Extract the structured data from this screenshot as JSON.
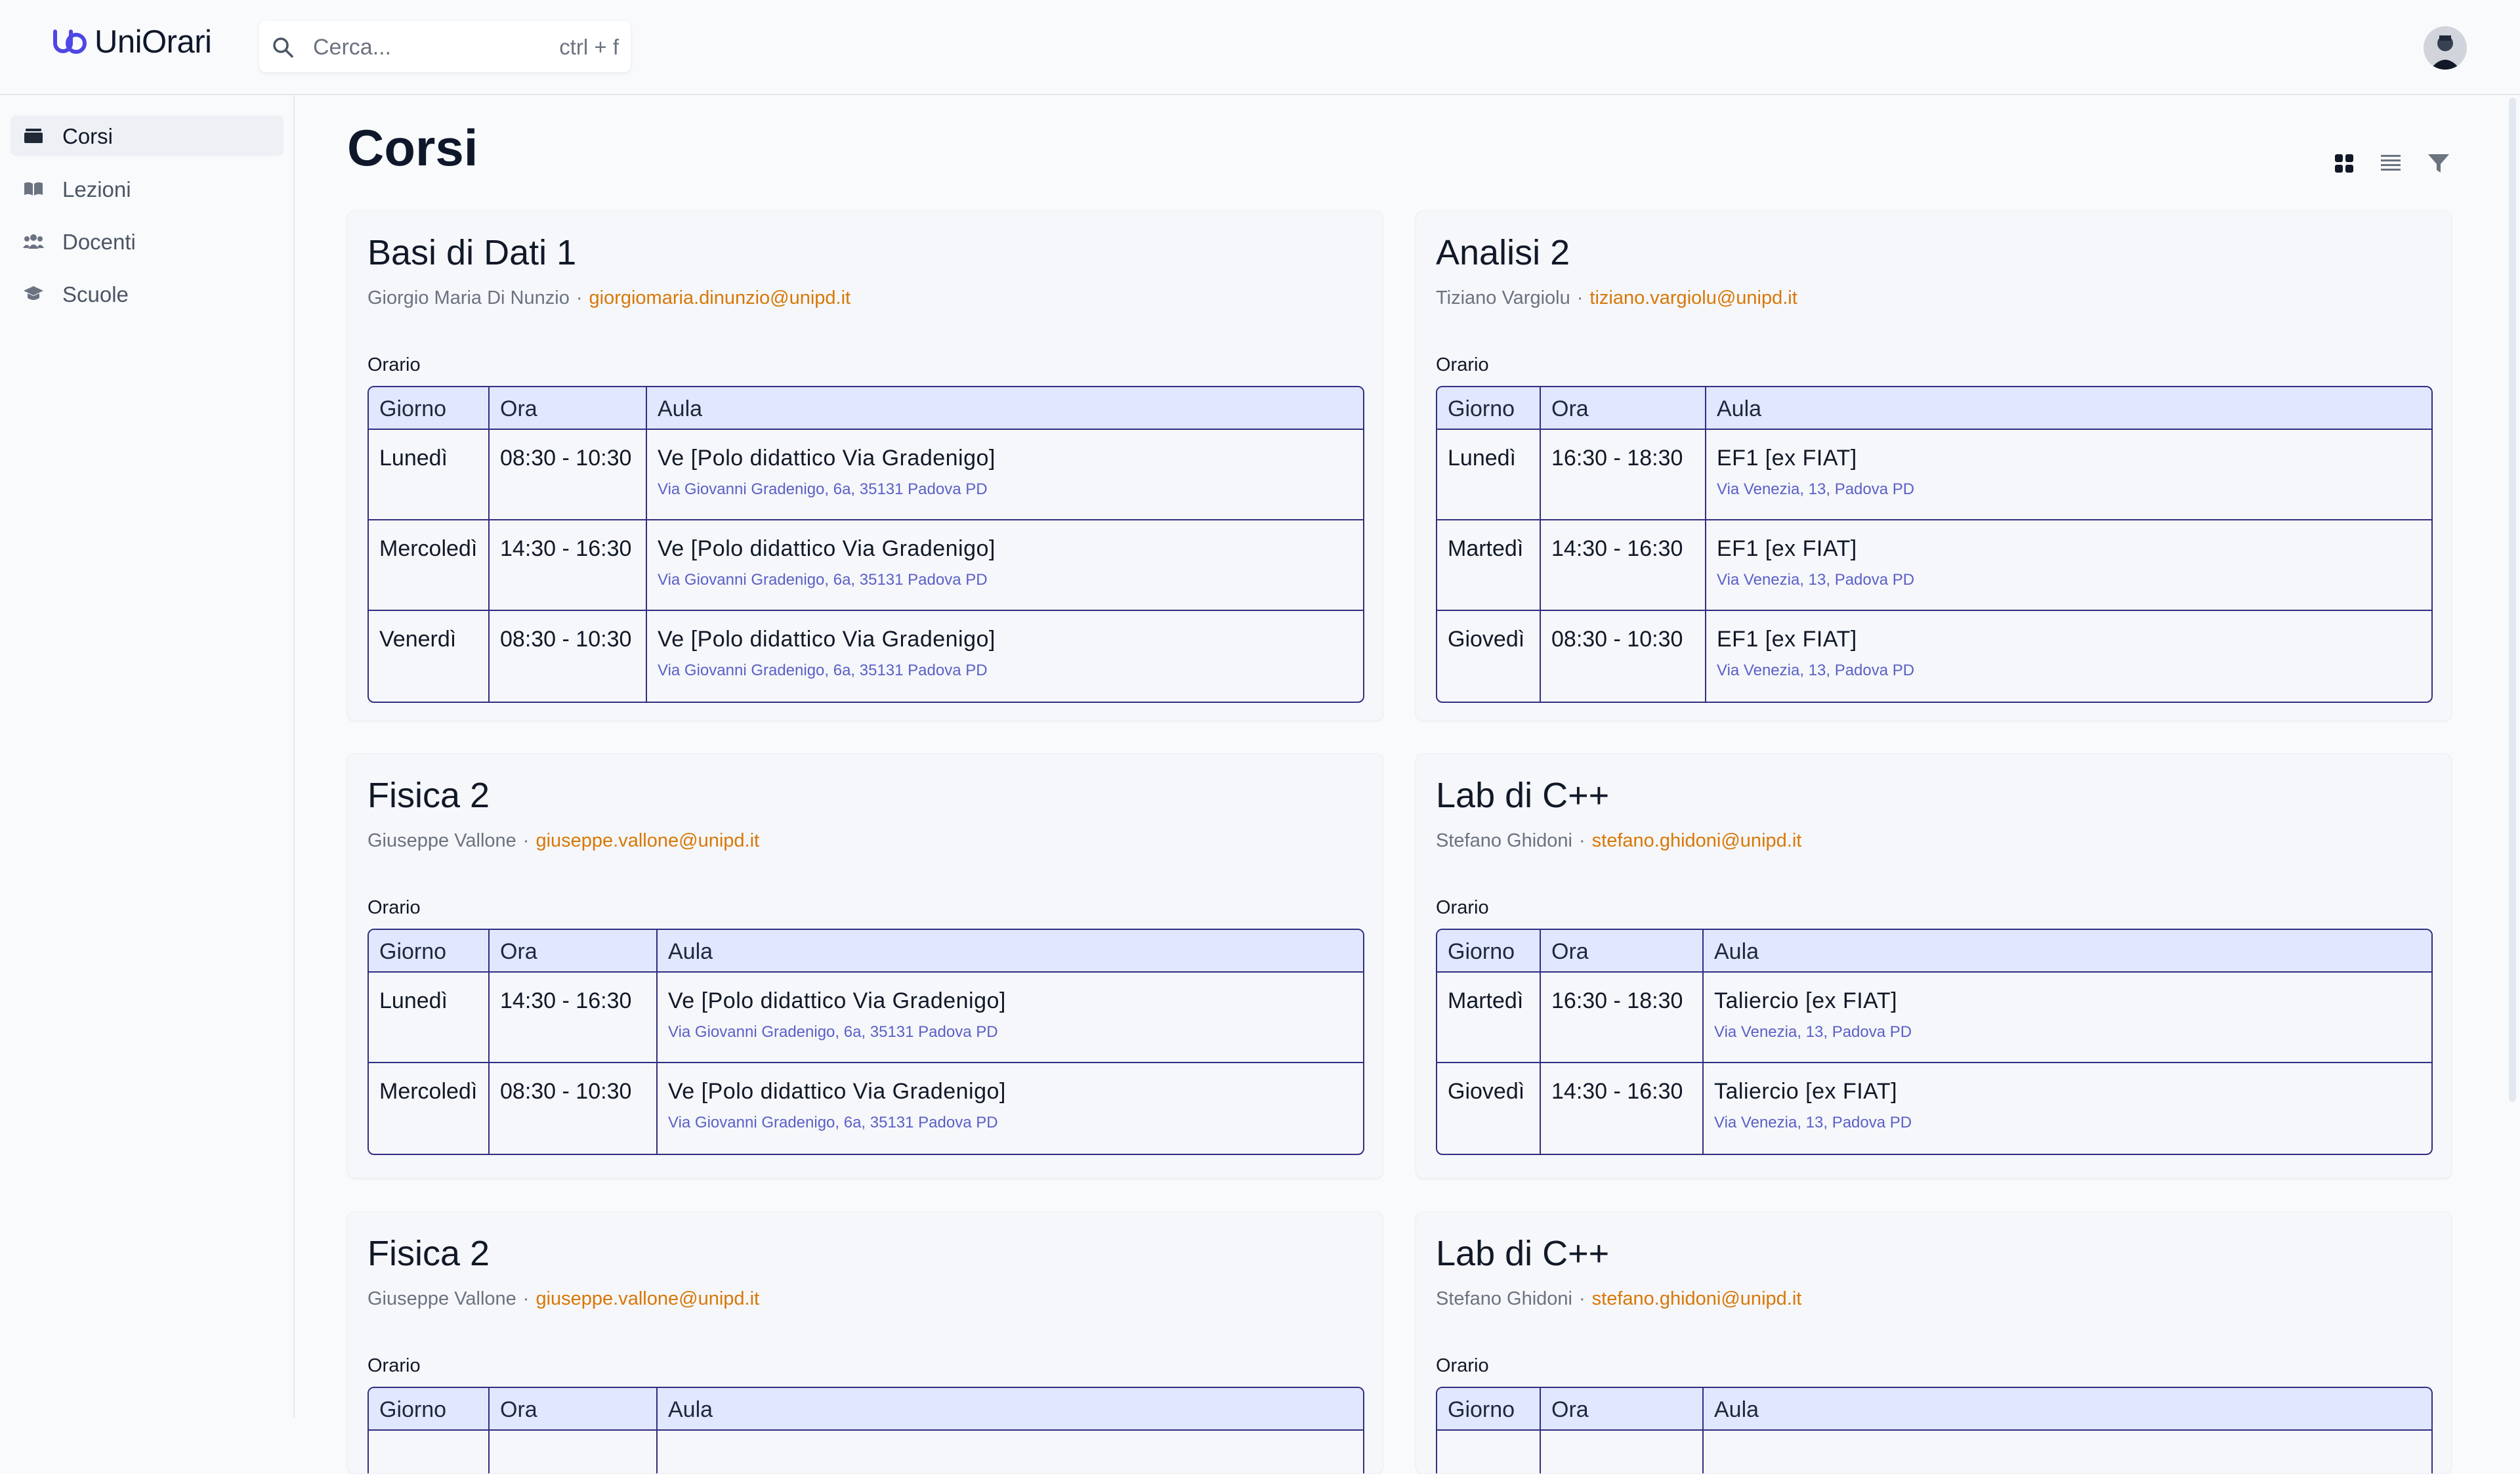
{
  "app": {
    "name": "UniOrari",
    "search_placeholder": "Cerca...",
    "search_hint": "ctrl + f"
  },
  "sidebar": {
    "items": [
      {
        "label": "Corsi",
        "icon": "briefcase-icon",
        "active": true
      },
      {
        "label": "Lezioni",
        "icon": "book-open-icon",
        "active": false
      },
      {
        "label": "Docenti",
        "icon": "users-icon",
        "active": false
      },
      {
        "label": "Scuole",
        "icon": "graduation-cap-icon",
        "active": false
      }
    ]
  },
  "page": {
    "title": "Corsi",
    "view_buttons": [
      "grid-view-icon",
      "list-view-icon",
      "filter-icon"
    ]
  },
  "table_headers": {
    "day": "Giorno",
    "time": "Ora",
    "room": "Aula"
  },
  "orario_label": "Orario",
  "courses": [
    {
      "title": "Basi di Dati 1",
      "teacher": "Giorgio Maria Di Nunzio",
      "email": "giorgiomaria.dinunzio@unipd.it",
      "rows": [
        {
          "day": "Lunedì",
          "time": "08:30 - 10:30",
          "room": "Ve [Polo didattico Via Gradenigo]",
          "address": "Via Giovanni Gradenigo, 6a, 35131 Padova PD"
        },
        {
          "day": "Mercoledì",
          "time": "14:30 - 16:30",
          "room": "Ve [Polo didattico Via Gradenigo]",
          "address": "Via Giovanni Gradenigo, 6a, 35131 Padova PD"
        },
        {
          "day": "Venerdì",
          "time": "08:30 - 10:30",
          "room": "Ve [Polo didattico Via Gradenigo]",
          "address": "Via Giovanni Gradenigo, 6a, 35131 Padova PD"
        }
      ]
    },
    {
      "title": "Analisi 2",
      "teacher": "Tiziano Vargiolu",
      "email": "tiziano.vargiolu@unipd.it",
      "rows": [
        {
          "day": "Lunedì",
          "time": "16:30 - 18:30",
          "room": "EF1 [ex FIAT]",
          "address": "Via Venezia, 13, Padova PD"
        },
        {
          "day": "Martedì",
          "time": "14:30 - 16:30",
          "room": "EF1 [ex FIAT]",
          "address": "Via Venezia, 13, Padova PD"
        },
        {
          "day": "Giovedì",
          "time": "08:30 - 10:30",
          "room": "EF1 [ex FIAT]",
          "address": "Via Venezia, 13, Padova PD"
        }
      ]
    },
    {
      "title": "Fisica 2",
      "teacher": "Giuseppe Vallone",
      "email": "giuseppe.vallone@unipd.it",
      "rows": [
        {
          "day": "Lunedì",
          "time": "14:30 - 16:30",
          "room": "Ve [Polo didattico Via Gradenigo]",
          "address": "Via Giovanni Gradenigo, 6a, 35131 Padova PD"
        },
        {
          "day": "Mercoledì",
          "time": "08:30 - 10:30",
          "room": "Ve [Polo didattico Via Gradenigo]",
          "address": "Via Giovanni Gradenigo, 6a, 35131 Padova PD"
        }
      ]
    },
    {
      "title": "Lab di C++",
      "teacher": "Stefano Ghidoni",
      "email": "stefano.ghidoni@unipd.it",
      "rows": [
        {
          "day": "Martedì",
          "time": "16:30 - 18:30",
          "room": "Taliercio [ex FIAT]",
          "address": "Via Venezia, 13, Padova PD"
        },
        {
          "day": "Giovedì",
          "time": "14:30 - 16:30",
          "room": "Taliercio [ex FIAT]",
          "address": "Via Venezia, 13, Padova PD"
        }
      ]
    },
    {
      "title": "Fisica 2",
      "teacher": "Giuseppe Vallone",
      "email": "giuseppe.vallone@unipd.it",
      "rows": []
    },
    {
      "title": "Lab di C++",
      "teacher": "Stefano Ghidoni",
      "email": "stefano.ghidoni@unipd.it",
      "rows": []
    }
  ],
  "colors": {
    "accent_email": "#d97706",
    "table_border": "#312e81",
    "table_header_bg": "#e0e7ff",
    "address": "#5b5fc7",
    "logo": "#4f46e5"
  }
}
